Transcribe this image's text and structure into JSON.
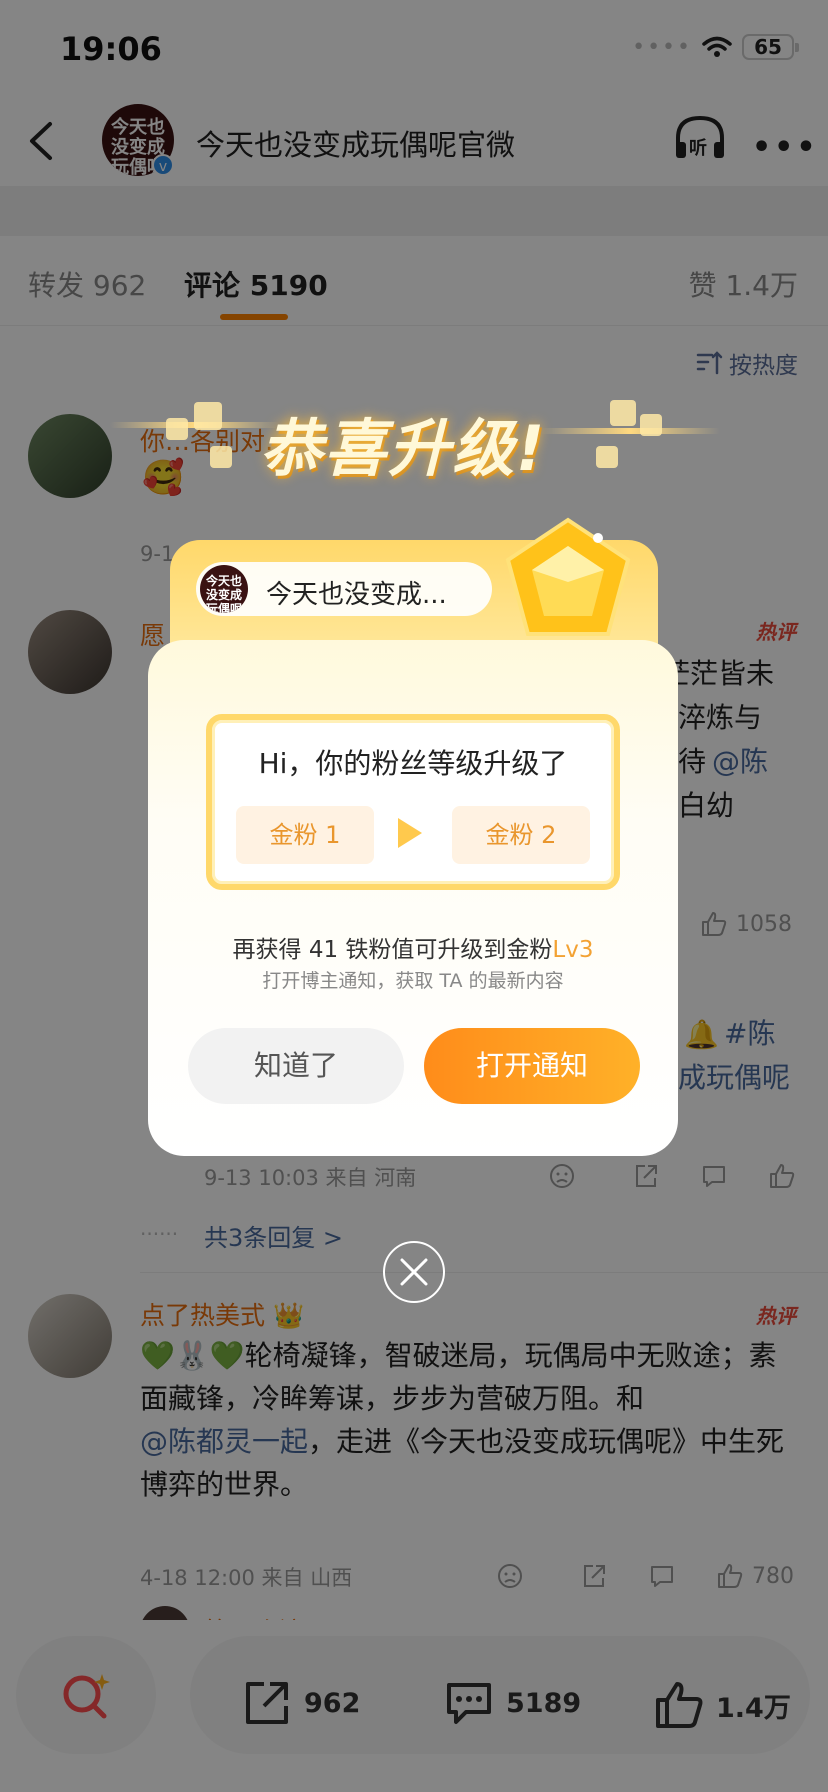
{
  "status_bar": {
    "time": "19:06",
    "battery": "65"
  },
  "nav": {
    "title": "今天也没变成玩偶呢官微",
    "avatar_text": "今天也没变成玩偶呢"
  },
  "tabs": [
    {
      "label": "转发 962"
    },
    {
      "label": "评论 5190"
    },
    {
      "label": "赞 1.4万"
    }
  ],
  "sort": {
    "label": "按热度"
  },
  "comments": [
    {
      "name": "你…各别对…",
      "date": "9-1…"
    },
    {
      "name": "愿",
      "hot": "热评",
      "text_visible_right": [
        "茫茫皆未",
        "淬炼与",
        "待",
        "@陈",
        "白幼"
      ],
      "likes": "1058",
      "topic_right": [
        "#陈",
        "成玩偶呢"
      ],
      "meta": "9-13 10:03  来自 河南",
      "replies": "共3条回复 >"
    },
    {
      "name": "点了热美式",
      "hot": "热评",
      "text_prefix": "轮椅凝锋，智破迷局，玩偶局中无败途；素面藏锋，冷眸筹谋，步步为营破万阻。和",
      "mention": "@陈都灵一起",
      "text_suffix": "，走进《今天也没变成玩偶呢》中生死博弈的世界。",
      "meta": "4-18 12:00  来自 山西",
      "likes": "780"
    },
    {
      "name": "第三个流星雨"
    }
  ],
  "bottom_bar": {
    "reposts": "962",
    "comments": "5189",
    "likes": "1.4万"
  },
  "popup": {
    "title": "恭喜升级!",
    "account_name": "今天也没变成...",
    "heading": "Hi，你的粉丝等级升级了",
    "from_level": "金粉 1",
    "to_level": "金粉 2",
    "hint_main": "再获得 41 铁粉值可升级到金粉",
    "hint_level": "Lv3",
    "hint_sub": "打开博主通知，获取 TA 的最新内容",
    "btn_ok": "知道了",
    "btn_notify": "打开通知"
  },
  "colors": {
    "accent": "#ff8200",
    "link": "#4a6a9e",
    "gold": "#ffd86a"
  }
}
